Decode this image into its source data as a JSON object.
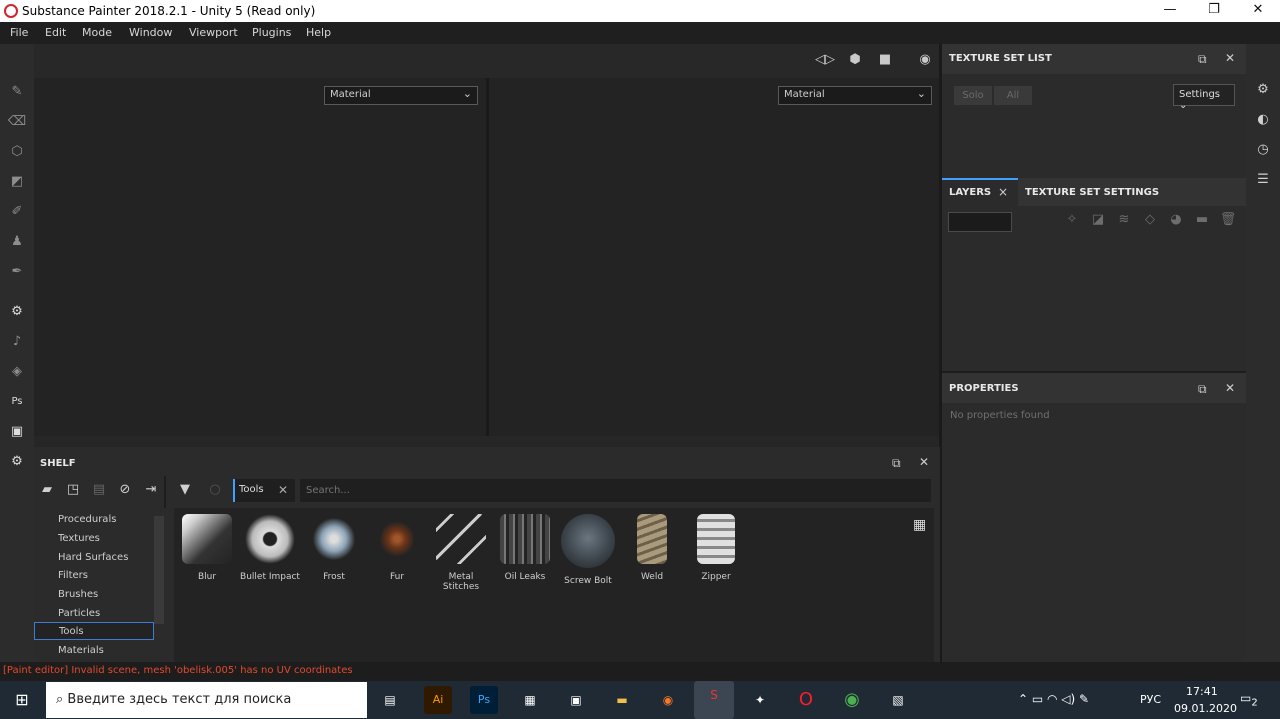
{
  "window": {
    "title": "Substance Painter 2018.2.1 - Unity 5 (Read only)",
    "minimize": "—",
    "maximize": "❐",
    "close": "✕"
  },
  "menu": [
    "File",
    "Edit",
    "Mode",
    "Window",
    "Viewport",
    "Plugins",
    "Help"
  ],
  "viewport": {
    "left_select": "Material",
    "right_select": "Material"
  },
  "texture_set_list": {
    "title": "TEXTURE SET LIST",
    "solo": "Solo",
    "all": "All",
    "settings": "Settings"
  },
  "layers": {
    "tab_label": "LAYERS",
    "close": "×",
    "texture_set_settings_tab": "TEXTURE SET SETTINGS"
  },
  "properties": {
    "title": "PROPERTIES",
    "empty_text": "No properties found"
  },
  "shelf": {
    "title": "SHELF",
    "filter_chip": "Tools",
    "search_placeholder": "Search...",
    "categories": [
      "Procedurals",
      "Textures",
      "Hard Surfaces",
      "Filters",
      "Brushes",
      "Particles",
      "Tools",
      "Materials"
    ],
    "selected_category": "Tools",
    "assets": [
      "Blur",
      "Bullet Impact",
      "Frost",
      "Fur",
      "Metal Stitches",
      "Oil Leaks",
      "Screw Bolt",
      "Weld",
      "Zipper"
    ]
  },
  "status": {
    "message": "[Paint editor] Invalid scene, mesh 'obelisk.005' has no UV coordinates"
  },
  "taskbar": {
    "search_placeholder": "Введите здесь текст для поиска",
    "lang": "РУС",
    "time": "17:41",
    "date": "09.01.2020",
    "notifications": "2"
  },
  "colors": {
    "accent": "#3ea0ff",
    "selection_border": "#3e7bd6",
    "status_error": "#e24a2f"
  }
}
